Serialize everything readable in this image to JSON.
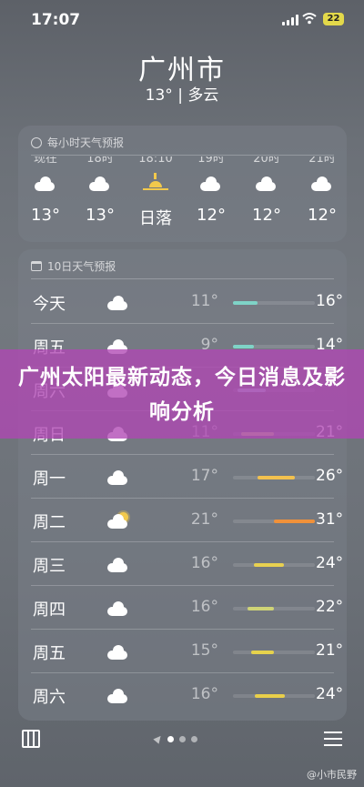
{
  "status": {
    "time": "17:07",
    "battery": "22"
  },
  "header": {
    "city": "广州市",
    "condition": "13° | 多云"
  },
  "hourly": {
    "title": "每小时天气预报",
    "hours": [
      {
        "label": "现在",
        "icon": "cloud-icon",
        "temp": "13°"
      },
      {
        "label": "18时",
        "icon": "cloud-icon",
        "temp": "13°"
      },
      {
        "label": "18:10",
        "icon": "sunset-icon",
        "temp": "日落"
      },
      {
        "label": "19时",
        "icon": "cloud-icon",
        "temp": "12°"
      },
      {
        "label": "20时",
        "icon": "cloud-icon",
        "temp": "12°"
      },
      {
        "label": "21时",
        "icon": "cloud-icon",
        "temp": "12°"
      }
    ]
  },
  "daily": {
    "title": "10日天气预报",
    "days": [
      {
        "name": "今天",
        "icon": "cloud-icon",
        "low": "11°",
        "high": "16°",
        "bar_start": 0.0,
        "bar_end": 0.3,
        "bar_color": "#7fd3c7"
      },
      {
        "name": "周五",
        "icon": "cloud-icon",
        "low": "9°",
        "high": "14°",
        "bar_start": 0.0,
        "bar_end": 0.25,
        "bar_color": "#7fd3c7"
      },
      {
        "name": "周六",
        "icon": "cloud-icon",
        "low": "",
        "high": "",
        "bar_start": 0.05,
        "bar_end": 0.4,
        "bar_color": "#a9c7d6"
      },
      {
        "name": "周日",
        "icon": "cloud-icon",
        "low": "11°",
        "high": "21°",
        "bar_start": 0.1,
        "bar_end": 0.5,
        "bar_color": "#c8cf8a"
      },
      {
        "name": "周一",
        "icon": "cloud-icon",
        "low": "17°",
        "high": "26°",
        "bar_start": 0.3,
        "bar_end": 0.75,
        "bar_color": "#f2c14e"
      },
      {
        "name": "周二",
        "icon": "partly-sunny-icon",
        "low": "21°",
        "high": "31°",
        "bar_start": 0.5,
        "bar_end": 1.0,
        "bar_color": "#f0913a"
      },
      {
        "name": "周三",
        "icon": "cloud-icon",
        "low": "16°",
        "high": "24°",
        "bar_start": 0.25,
        "bar_end": 0.62,
        "bar_color": "#e8d050"
      },
      {
        "name": "周四",
        "icon": "cloud-icon",
        "low": "16°",
        "high": "22°",
        "bar_start": 0.18,
        "bar_end": 0.5,
        "bar_color": "#cfd476"
      },
      {
        "name": "周五",
        "icon": "cloud-icon",
        "low": "15°",
        "high": "21°",
        "bar_start": 0.22,
        "bar_end": 0.5,
        "bar_color": "#e6d24c"
      },
      {
        "name": "周六",
        "icon": "cloud-icon",
        "low": "16°",
        "high": "24°",
        "bar_start": 0.27,
        "bar_end": 0.63,
        "bar_color": "#e9cf4a"
      }
    ]
  },
  "banner": {
    "text": "广州太阳最新动态，今日消息及影响分析"
  },
  "bottom": {
    "watermark": "@小市民野"
  },
  "colors": {
    "banner": "#af46b4",
    "battery": "#e3d94a"
  }
}
